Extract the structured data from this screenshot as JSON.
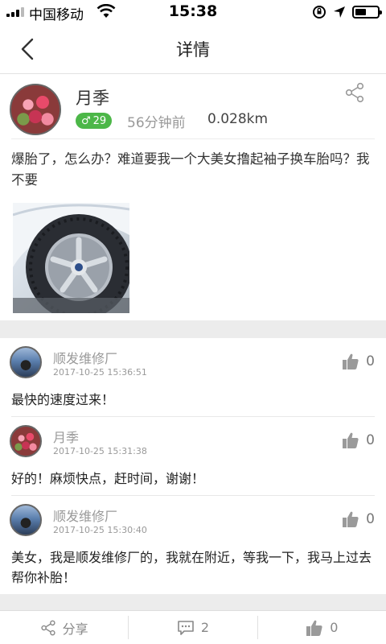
{
  "status_bar": {
    "carrier": "中国移动",
    "time": "15:38",
    "battery_level": 0.5
  },
  "nav": {
    "title": "详情",
    "back_icon": "chevron-left-icon"
  },
  "post": {
    "author": "月季",
    "gender_symbol": "♂",
    "age": "29",
    "time_ago": "56分钟前",
    "distance": "0.028km",
    "text": "爆胎了，怎么办？难道要我一个大美女撸起袖子换车胎吗？我不要",
    "photo_icon": "car-tire-photo"
  },
  "comments": [
    {
      "name": "顺发维修厂",
      "timestamp": "2017-10-25 15:36:51",
      "likes": "0",
      "text": "最快的速度过来！"
    },
    {
      "name": "月季",
      "timestamp": "2017-10-25 15:31:38",
      "likes": "0",
      "text": "好的！麻烦快点，赶时间，谢谢！"
    },
    {
      "name": "顺发维修厂",
      "timestamp": "2017-10-25 15:30:40",
      "likes": "0",
      "text": "美女，我是顺发维修厂的，我就在附近，等我一下，我马上过去帮你补胎！"
    }
  ],
  "bottom_bar": {
    "share_label": "分享",
    "comment_count": "2",
    "like_count": "0"
  },
  "colors": {
    "badge_green": "#4cb748",
    "divider_gray": "#ececec"
  }
}
